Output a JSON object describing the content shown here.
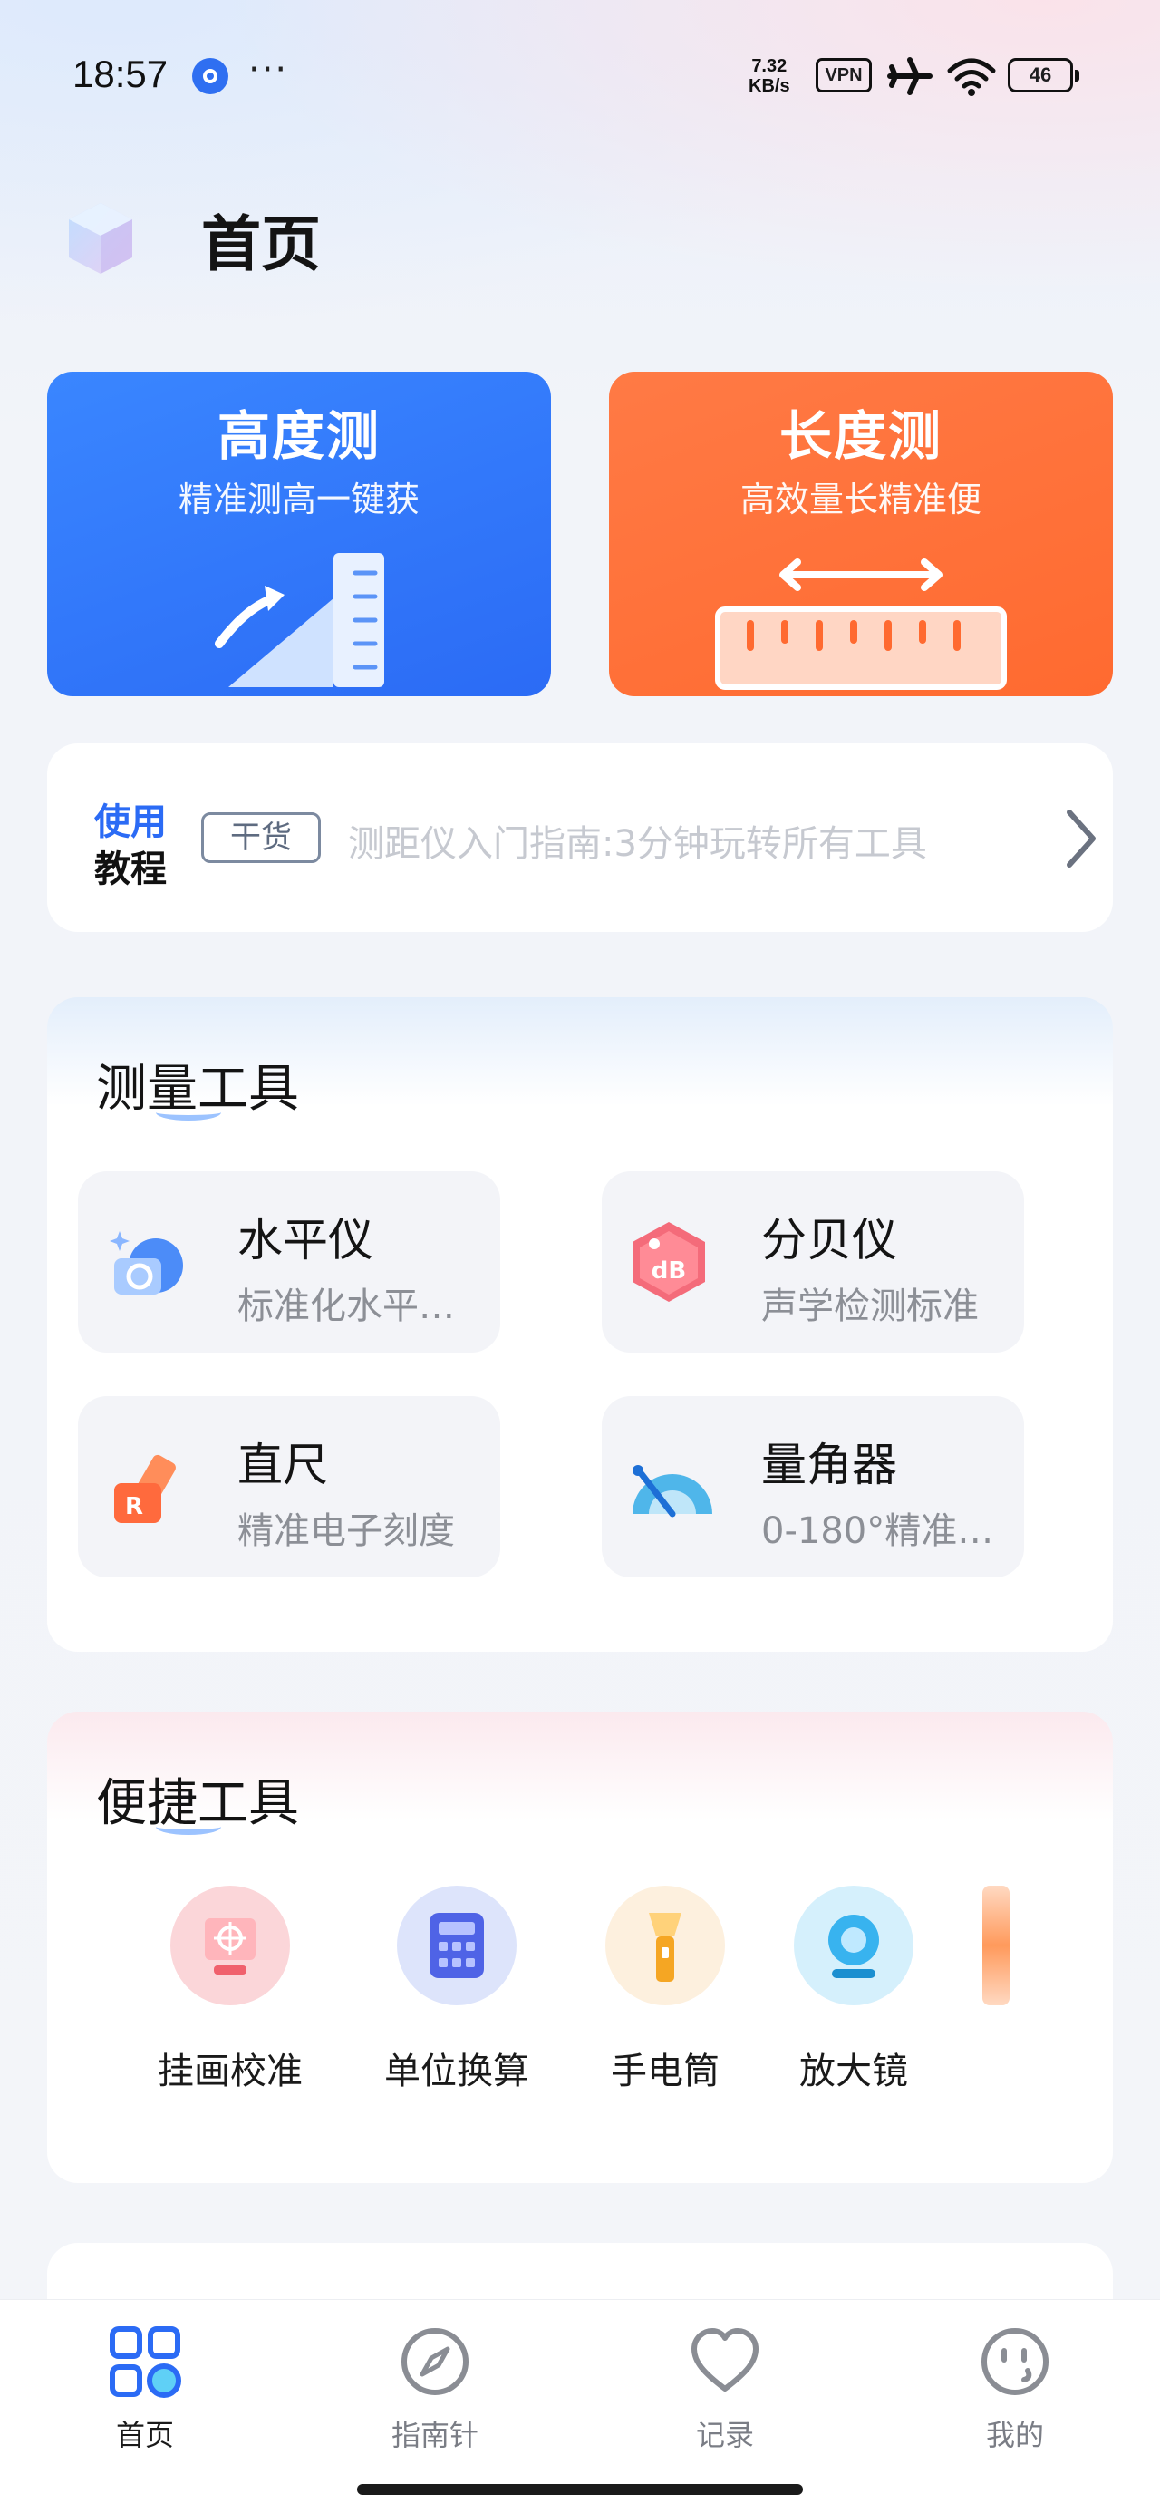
{
  "status_bar": {
    "time": "18:57",
    "more": "···",
    "speed_value": "7.32",
    "speed_unit": "KB/s",
    "vpn": "VPN",
    "battery": "46",
    "icons": [
      "app-notification-icon",
      "airplane-icon",
      "wifi-icon",
      "battery-icon"
    ]
  },
  "header": {
    "title": "首页",
    "logo": "cube-logo-icon"
  },
  "hero_cards": [
    {
      "title": "高度测",
      "subtitle": "精准测高一键获",
      "color": "#2f72f8",
      "icon": "height-ruler-icon"
    },
    {
      "title": "长度测",
      "subtitle": "高效量长精准便",
      "color": "#ff6f37",
      "icon": "length-ruler-icon"
    }
  ],
  "tutorial": {
    "label_line1": "使用",
    "label_line2": "教程",
    "tag": "干货",
    "text": "测距仪入门指南:3分钟玩转所有工具",
    "chevron": "chevron-right-icon"
  },
  "measure_tools": {
    "title": "测量工具",
    "items": [
      {
        "name": "水平仪",
        "desc": "标准化水平…",
        "icon": "level-icon"
      },
      {
        "name": "分贝仪",
        "desc": "声学检测标准",
        "icon": "decibel-icon"
      },
      {
        "name": "直尺",
        "desc": "精准电子刻度",
        "icon": "ruler-icon"
      },
      {
        "name": "量角器",
        "desc": "0-180°精准…",
        "icon": "protractor-icon"
      }
    ]
  },
  "quick_tools": {
    "title": "便捷工具",
    "items": [
      {
        "label": "挂画校准",
        "icon": "picture-calibrate-icon"
      },
      {
        "label": "单位换算",
        "icon": "calculator-icon"
      },
      {
        "label": "手电筒",
        "icon": "flashlight-icon"
      },
      {
        "label": "放大镜",
        "icon": "magnifier-icon"
      }
    ]
  },
  "tabbar": {
    "items": [
      {
        "label": "首页",
        "icon": "home-grid-icon",
        "active": true
      },
      {
        "label": "指南针",
        "icon": "compass-icon",
        "active": false
      },
      {
        "label": "记录",
        "icon": "heart-icon",
        "active": false
      },
      {
        "label": "我的",
        "icon": "smile-face-icon",
        "active": false
      }
    ]
  }
}
